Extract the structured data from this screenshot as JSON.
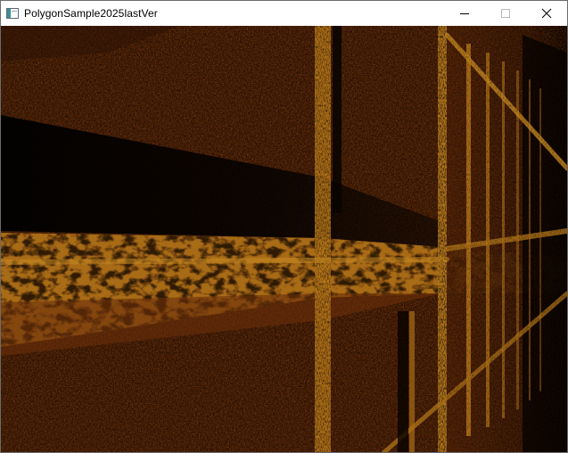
{
  "window": {
    "title": "PolygonSample2025lastVer",
    "icon": "app-window-icon",
    "controls": {
      "minimize_icon": "minimize-icon",
      "maximize_icon": "maximize-icon",
      "close_icon": "close-icon"
    }
  },
  "scene": {
    "description_colors": {
      "wall_base": "#3a1804",
      "wall_mid": "#6b3210",
      "gold": "#b07014",
      "bright_gold": "#d4960c",
      "shadow": "#050200"
    }
  }
}
